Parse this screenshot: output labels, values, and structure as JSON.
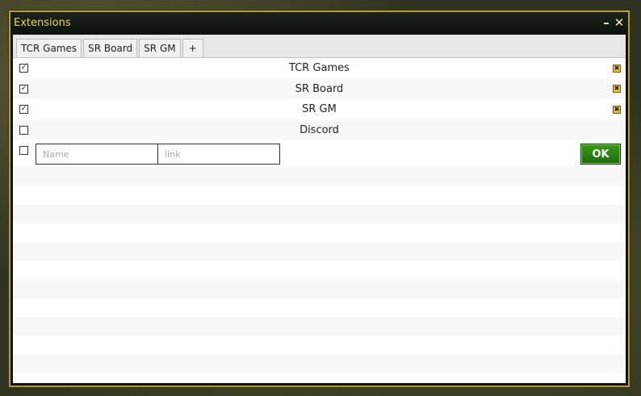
{
  "window": {
    "title": "Extensions"
  },
  "tabs": [
    {
      "label": "TCR Games"
    },
    {
      "label": "SR Board"
    },
    {
      "label": "SR GM"
    },
    {
      "label": "+"
    }
  ],
  "extensions": [
    {
      "name": "TCR Games",
      "checked": true,
      "deletable": true
    },
    {
      "name": "SR Board",
      "checked": true,
      "deletable": true
    },
    {
      "name": "SR GM",
      "checked": true,
      "deletable": true
    },
    {
      "name": "Discord",
      "checked": false,
      "deletable": false
    }
  ],
  "new_entry": {
    "name_placeholder": "Name",
    "link_placeholder": "link",
    "ok_label": "OK"
  },
  "icons": {
    "check": "✓",
    "delete": "✖",
    "minimize": "–",
    "close": "✕"
  }
}
